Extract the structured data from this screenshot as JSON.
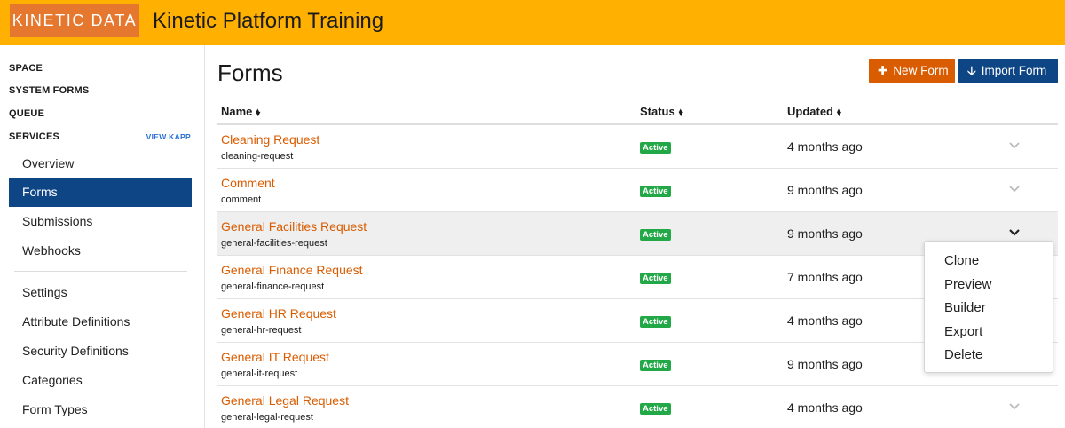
{
  "header": {
    "logo_text": "KINETIC DATA",
    "app_title": "Kinetic Platform Training",
    "bg_color": "#ffb000",
    "logo_color": "#e6772e"
  },
  "sidebar": {
    "sections": [
      "SPACE",
      "SYSTEM FORMS",
      "QUEUE",
      "SERVICES"
    ],
    "view_kapp": "VIEW KAPP",
    "items": [
      {
        "label": "Overview",
        "active": false
      },
      {
        "label": "Forms",
        "active": true
      },
      {
        "label": "Submissions",
        "active": false
      },
      {
        "label": "Webhooks",
        "active": false
      }
    ],
    "settings_items": [
      {
        "label": "Settings"
      },
      {
        "label": "Attribute Definitions"
      },
      {
        "label": "Security Definitions"
      },
      {
        "label": "Categories"
      },
      {
        "label": "Form Types"
      }
    ],
    "active_color": "#0d4585"
  },
  "main": {
    "title": "Forms",
    "new_button": "New Form",
    "import_button": "Import Form",
    "columns": {
      "name": "Name",
      "status": "Status",
      "updated": "Updated"
    },
    "rows": [
      {
        "name": "Cleaning Request",
        "slug": "cleaning-request",
        "status": "Active",
        "updated": "4 months ago"
      },
      {
        "name": "Comment",
        "slug": "comment",
        "status": "Active",
        "updated": "9 months ago"
      },
      {
        "name": "General Facilities Request",
        "slug": "general-facilities-request",
        "status": "Active",
        "updated": "9 months ago"
      },
      {
        "name": "General Finance Request",
        "slug": "general-finance-request",
        "status": "Active",
        "updated": "7 months ago"
      },
      {
        "name": "General HR Request",
        "slug": "general-hr-request",
        "status": "Active",
        "updated": "4 months ago"
      },
      {
        "name": "General IT Request",
        "slug": "general-it-request",
        "status": "Active",
        "updated": "9 months ago"
      },
      {
        "name": "General Legal Request",
        "slug": "general-legal-request",
        "status": "Active",
        "updated": "4 months ago"
      }
    ],
    "link_color": "#d95c00",
    "badge_color": "#22a846"
  },
  "row_menu": {
    "items": [
      "Clone",
      "Preview",
      "Builder",
      "Export",
      "Delete"
    ]
  },
  "icons": {
    "plus": "plus-icon",
    "arrow_down": "arrow-down-icon",
    "sort": "sort-icon",
    "chevron": "chevron-down-icon"
  }
}
